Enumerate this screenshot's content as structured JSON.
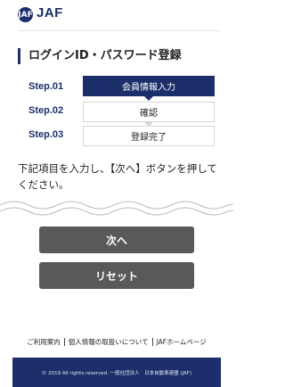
{
  "header": {
    "logo_mark": "JAF",
    "logo_text": "JAF"
  },
  "page_title": "ログインID・パスワード登録",
  "steps": [
    {
      "label": "Step.01",
      "name": "会員情報入力",
      "active": true
    },
    {
      "label": "Step.02",
      "name": "確認",
      "active": false
    },
    {
      "label": "Step.03",
      "name": "登録完了",
      "active": false
    }
  ],
  "instructions": "下記項目を入力し、【次へ】ボタンを押してください。",
  "buttons": {
    "next": "次へ",
    "reset": "リセット"
  },
  "footer": {
    "links": [
      "ご利用案内",
      "個人情報の取扱いについて",
      "JAFホームページ"
    ],
    "copyright": "© 2019 All rights reserved. 一般社団法人　日本自動車連盟 (JAF)"
  },
  "colors": {
    "brand": "#1c2f6a",
    "button": "#58595b"
  }
}
